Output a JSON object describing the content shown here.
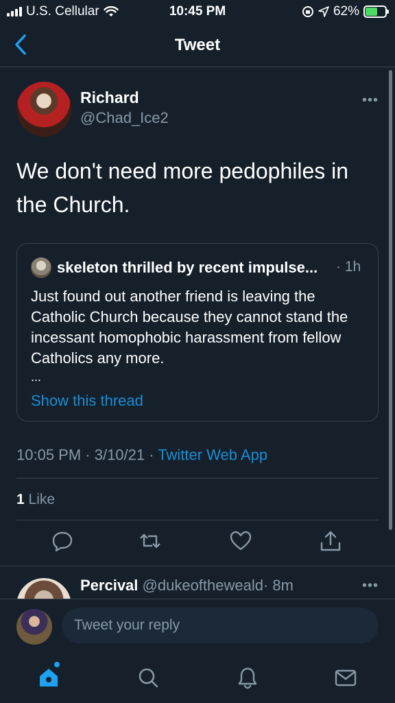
{
  "status_bar": {
    "carrier": "U.S. Cellular",
    "time": "10:45 PM",
    "battery": "62%",
    "battery_level": 0.62,
    "icons": [
      "signal-icon",
      "wifi-icon",
      "screen-lock-icon",
      "location-icon",
      "battery-icon"
    ]
  },
  "header": {
    "title": "Tweet",
    "back_icon": "chevron-left-icon"
  },
  "tweet": {
    "author_name": "Richard",
    "author_handle": "@Chad_Ice2",
    "text": "We don't need more pedophiles in the Church.",
    "more_icon": "more-dots-icon",
    "quote": {
      "author": "skeleton thrilled by recent impulse...",
      "time": "· 1h",
      "text": "Just found out another friend is leaving the Catholic Church because they cannot stand the incessant homophobic harassment from fellow Catholics any more.",
      "ellipsis": "...",
      "show_thread": "Show this thread"
    },
    "timestamp": "10:05 PM · 3/10/21 · ",
    "source": "Twitter Web App",
    "like_count": "1",
    "like_label": " Like",
    "actions": [
      "reply-icon",
      "retweet-icon",
      "like-icon",
      "share-icon"
    ]
  },
  "reply_preview": {
    "name": "Percival",
    "handle": "@dukeoftheweald",
    "time": "· 8m"
  },
  "compose": {
    "placeholder": "Tweet your reply"
  },
  "tab_bar": {
    "tabs": [
      "home-icon",
      "search-icon",
      "notifications-icon",
      "messages-icon"
    ]
  },
  "colors": {
    "background": "#15202b",
    "accent": "#1da1f2",
    "secondary_text": "#8899a6",
    "border": "#38444d"
  }
}
